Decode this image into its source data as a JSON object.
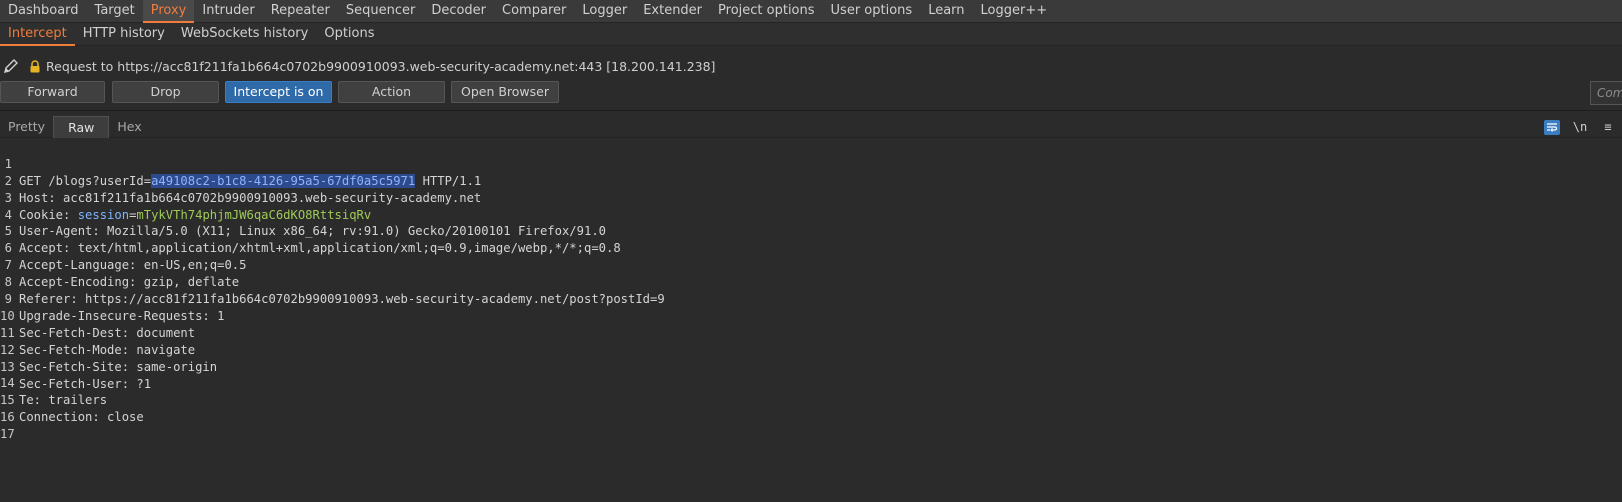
{
  "top_tabs": [
    "Dashboard",
    "Target",
    "Proxy",
    "Intruder",
    "Repeater",
    "Sequencer",
    "Decoder",
    "Comparer",
    "Logger",
    "Extender",
    "Project options",
    "User options",
    "Learn",
    "Logger++"
  ],
  "active_top_tab": "Proxy",
  "sub_tabs": [
    "Intercept",
    "HTTP history",
    "WebSockets history",
    "Options"
  ],
  "active_sub_tab": "Intercept",
  "request_info": "Request to https://acc81f211fa1b664c0702b9900910093.web-security-academy.net:443  [18.200.141.238]",
  "toolbar": {
    "forward": "Forward",
    "drop": "Drop",
    "intercept": "Intercept is on",
    "action": "Action",
    "open_browser": "Open Browser",
    "comment_placeholder": "Comment this item"
  },
  "view_tabs": [
    "Pretty",
    "Raw",
    "Hex"
  ],
  "active_view_tab": "Raw",
  "view_icons": {
    "newline": "\\n",
    "menu": "≡"
  },
  "request": {
    "method_line_prefix": "GET /blogs?userId=",
    "user_id": "a49108c2-b1c8-4126-95a5-67df0a5c5971",
    "method_line_suffix": " HTTP/1.1",
    "cookie_prefix": "Cookie: ",
    "cookie_name": "session",
    "cookie_eq": "=",
    "cookie_value": "mTykVTh74phjmJW6qaC6dKO8RttsiqRv",
    "lines": [
      "Host: acc81f211fa1b664c0702b9900910093.web-security-academy.net",
      "User-Agent: Mozilla/5.0 (X11; Linux x86_64; rv:91.0) Gecko/20100101 Firefox/91.0",
      "Accept: text/html,application/xhtml+xml,application/xml;q=0.9,image/webp,*/*;q=0.8",
      "Accept-Language: en-US,en;q=0.5",
      "Accept-Encoding: gzip, deflate",
      "Referer: https://acc81f211fa1b664c0702b9900910093.web-security-academy.net/post?postId=9",
      "Upgrade-Insecure-Requests: 1",
      "Sec-Fetch-Dest: document",
      "Sec-Fetch-Mode: navigate",
      "Sec-Fetch-Site: same-origin",
      "Sec-Fetch-User: ?1",
      "Te: trailers",
      "Connection: close"
    ]
  },
  "line_numbers": [
    "1",
    "2",
    "3",
    "4",
    "5",
    "6",
    "7",
    "8",
    "9",
    "10",
    "11",
    "12",
    "13",
    "14",
    "15",
    "16",
    "17"
  ],
  "colors": {
    "accent": "#f07c3c",
    "primary_button": "#2e6aa8",
    "highlight": "#2d4a8c",
    "cookie_value": "#9fca56"
  }
}
